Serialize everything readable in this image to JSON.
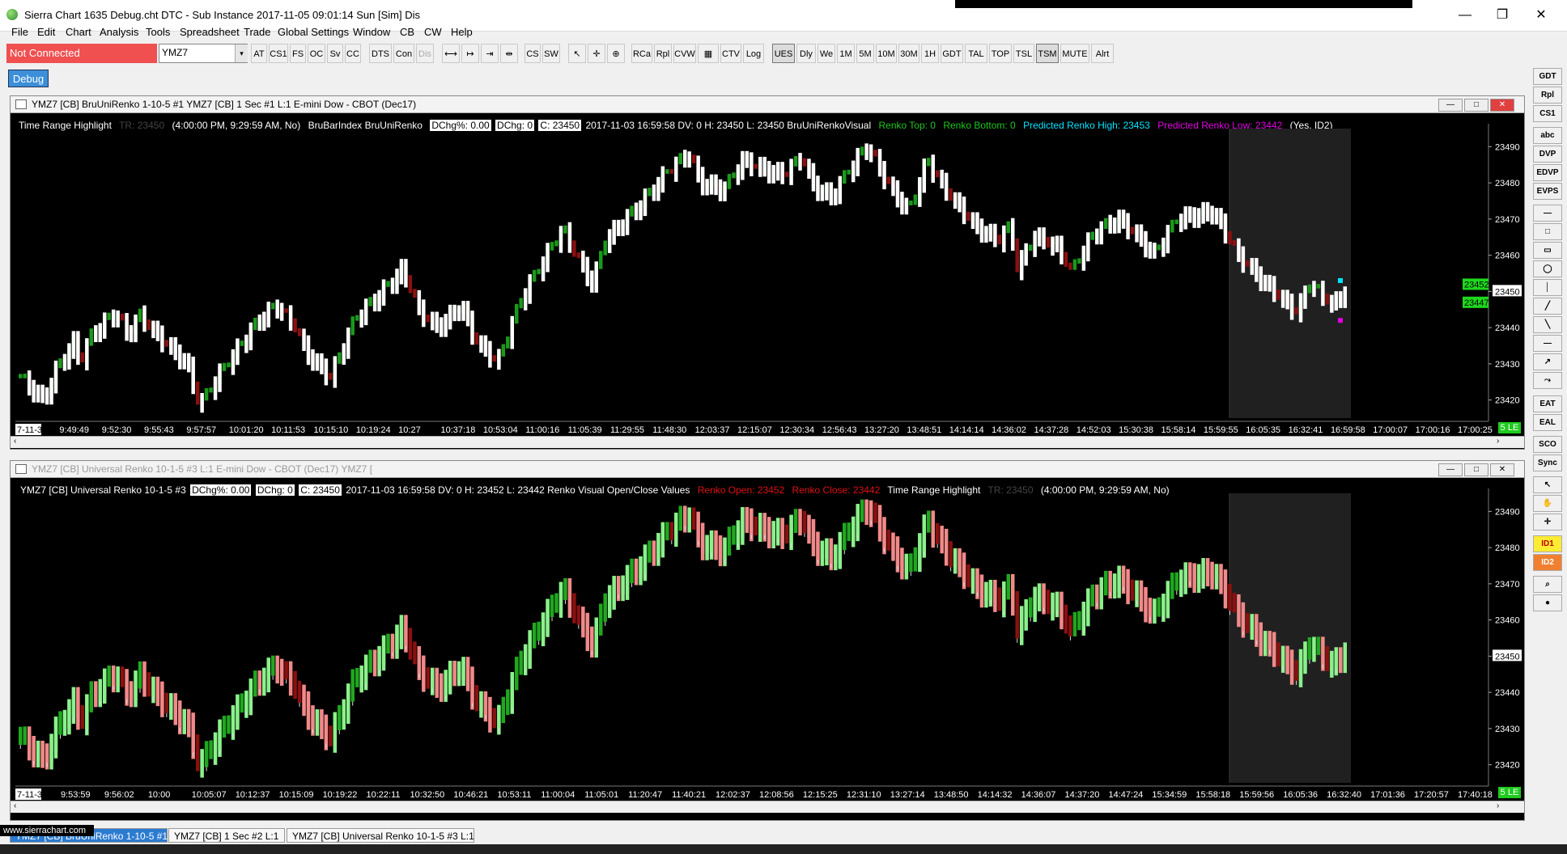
{
  "window": {
    "title": "Sierra Chart 1635 Debug.cht  DTC - Sub Instance 2017-11-05  09:01:14 Sun [Sim]  Dis",
    "minimize": "—",
    "restore": "❐",
    "close": "✕"
  },
  "menu": [
    "File",
    "Edit",
    "Chart",
    "Analysis",
    "Tools",
    "Spreadsheet",
    "Trade",
    "Global Settings",
    "Window",
    "CB",
    "CW",
    "Help"
  ],
  "toolbar": {
    "connection_status": "Not Connected",
    "symbol": "YMZ7",
    "dropdown_arrow": "▾",
    "debug_button": "Debug",
    "buttons": [
      {
        "label": "AT",
        "disabled": false
      },
      {
        "label": "CS1",
        "disabled": false
      },
      {
        "label": "FS",
        "disabled": false
      },
      {
        "label": "OC",
        "disabled": false
      },
      {
        "label": "Sv",
        "disabled": false
      },
      {
        "label": "CC",
        "disabled": false
      },
      {
        "label": "DTS",
        "disabled": false
      },
      {
        "label": "Con",
        "disabled": false
      },
      {
        "label": "Dis",
        "disabled": true
      },
      {
        "label": "⟷",
        "disabled": false
      },
      {
        "label": "↦",
        "disabled": false
      },
      {
        "label": "⇥",
        "disabled": false
      },
      {
        "label": "⇹",
        "disabled": false
      },
      {
        "label": "CS",
        "disabled": false
      },
      {
        "label": "SW",
        "disabled": false
      },
      {
        "label": "↖",
        "disabled": false
      },
      {
        "label": "✛",
        "disabled": false
      },
      {
        "label": "⊕",
        "disabled": false
      },
      {
        "label": "RCa",
        "disabled": false
      },
      {
        "label": "Rpl",
        "disabled": false
      },
      {
        "label": "CVW",
        "disabled": false
      },
      {
        "label": "▦",
        "disabled": false
      },
      {
        "label": "CTV",
        "disabled": false
      },
      {
        "label": "Log",
        "disabled": false
      },
      {
        "label": "UES",
        "disabled": false,
        "selected": true
      },
      {
        "label": "Dly",
        "disabled": false
      },
      {
        "label": "We",
        "disabled": false
      },
      {
        "label": "1M",
        "disabled": false
      },
      {
        "label": "5M",
        "disabled": false
      },
      {
        "label": "10M",
        "disabled": false
      },
      {
        "label": "30M",
        "disabled": false
      },
      {
        "label": "1H",
        "disabled": false
      },
      {
        "label": "GDT",
        "disabled": false
      },
      {
        "label": "TAL",
        "disabled": false
      },
      {
        "label": "TOP",
        "disabled": false
      },
      {
        "label": "TSL",
        "disabled": false
      },
      {
        "label": "TSM",
        "disabled": false,
        "selected": true
      },
      {
        "label": "MUTE",
        "disabled": false
      },
      {
        "label": "Alrt",
        "disabled": false
      }
    ]
  },
  "right_panel": [
    "GDT",
    "Rpl",
    "CS1",
    "abc",
    "DVP",
    "EDVP",
    "EVPS",
    "—",
    "□",
    "▭",
    "◯",
    "│",
    "╱",
    "╲",
    "―",
    "↗",
    "⤳",
    "EAT",
    "EAL",
    "SCO",
    "Sync",
    "↖",
    "✋",
    "✛",
    "ID1",
    "ID2",
    "⌕",
    "●"
  ],
  "chart1": {
    "title": "YMZ7 [CB] BruUniRenko 1-10-5 #1  YMZ7 [CB]  1 Sec  #1  L:1  E-mini Dow - CBOT (Dec17)",
    "info": {
      "study1": "Time Range Highlight",
      "tr_dim": "TR: 23450",
      "tr_vals": "(4:00:00 PM, 9:29:59 AM, No)",
      "study2": "BruBarIndex  BruUniRenko",
      "dchg_pct": "DChg%: 0.00",
      "dchg": "DChg: 0",
      "close": "C: 23450",
      "bar": "2017-11-03 16:59:58 DV: 0 H: 23450 L: 23450 BruUniRenkoVisual",
      "renko_top": "Renko Top: 0",
      "renko_bottom": "Renko Bottom: 0",
      "pred_high": "Predicted Renko High: 23453",
      "pred_low": "Predicted Renko Low: 23442",
      "tail": "(Yes, ID2)"
    },
    "price_ticks": [
      "23490",
      "23480",
      "23470",
      "23460",
      "23450",
      "23440",
      "23430",
      "23420"
    ],
    "price_markers": [
      "23452",
      "23447"
    ],
    "time_ticks": [
      "7-11-3",
      "9:49:49",
      "9:52:30",
      "9:55:43",
      "9:57:57",
      "10:01:20",
      "10:11:53",
      "10:15:10",
      "10:19:24",
      "10:27",
      "10:37:18",
      "10:53:04",
      "11:00:16",
      "11:05:39",
      "11:29:55",
      "11:48:30",
      "12:03:37",
      "12:15:07",
      "12:30:34",
      "12:56:43",
      "13:27:20",
      "13:48:51",
      "14:14:14",
      "14:36:02",
      "14:37:28",
      "14:52:03",
      "15:30:38",
      "15:58:14",
      "15:59:55",
      "16:05:35",
      "16:32:41",
      "16:59:58",
      "17:00:07",
      "17:00:16",
      "17:00:25"
    ],
    "sle": "5 LE",
    "colors": {
      "up": "#1a9a1a",
      "down": "#8b1010",
      "wick": "#ffffff",
      "highlight": "#202020",
      "cyan": "#00e5ff",
      "magenta": "#e000e0"
    }
  },
  "chart2": {
    "title": "YMZ7 [CB]  Universal Renko 10-1-5  #3  L:1  E-mini Dow - CBOT (Dec17)  YMZ7 [",
    "info": {
      "lead": "YMZ7 [CB]  Universal Renko 10-1-5  #3",
      "dchg_pct": "DChg%: 0.00",
      "dchg": "DChg: 0",
      "close": "C: 23450",
      "bar": "2017-11-03 16:59:58 DV: 0 H: 23452 L: 23442  Renko Visual Open/Close Values",
      "renko_open": "Renko Open: 23452",
      "renko_close": "Renko Close: 23442",
      "study": "Time Range Highlight",
      "tr_dim": "TR: 23450",
      "tr_vals": "(4:00:00 PM, 9:29:59 AM, No)"
    },
    "price_ticks": [
      "23490",
      "23480",
      "23470",
      "23460",
      "23450",
      "23440",
      "23430",
      "23420"
    ],
    "time_ticks": [
      "7-11-3",
      "9:53:59",
      "9:56:02",
      "10:00",
      "10:05:07",
      "10:12:37",
      "10:15:09",
      "10:19:22",
      "10:22:11",
      "10:32:50",
      "10:46:21",
      "10:53:11",
      "11:00:04",
      "11:05:01",
      "11:20:47",
      "11:40:21",
      "12:02:37",
      "12:08:56",
      "12:15:25",
      "12:31:10",
      "13:27:14",
      "13:48:50",
      "14:14:32",
      "14:36:07",
      "14:37:20",
      "14:47:24",
      "15:34:59",
      "15:58:18",
      "15:59:56",
      "16:05:36",
      "16:32:40",
      "17:01:36",
      "17:20:57",
      "17:40:18"
    ],
    "sle": "5 LE",
    "colors": {
      "up": "#1fa81f",
      "down": "#8b1010",
      "up_light": "#8cf08c",
      "down_light": "#f08a8a",
      "highlight": "#202020"
    }
  },
  "bottom_tabs": [
    "YMZ7 [CB] BruUniRenko 1-10-5 #1",
    "YMZ7 [CB]  1 Sec   #2  L:1",
    "YMZ7 [CB]  Universal Renko 10-1-5  #3  L:1"
  ],
  "watermark": "www.sierrachart.com",
  "path": [
    [
      0,
      23426
    ],
    [
      4,
      23420
    ],
    [
      6,
      23428
    ],
    [
      9,
      23436
    ],
    [
      10,
      23430
    ],
    [
      12,
      23438
    ],
    [
      16,
      23444
    ],
    [
      18,
      23438
    ],
    [
      20,
      23443
    ],
    [
      24,
      23436
    ],
    [
      28,
      23430
    ],
    [
      30,
      23418
    ],
    [
      33,
      23426
    ],
    [
      40,
      23442
    ],
    [
      43,
      23446
    ],
    [
      46,
      23440
    ],
    [
      48,
      23433
    ],
    [
      52,
      23426
    ],
    [
      56,
      23442
    ],
    [
      62,
      23452
    ],
    [
      64,
      23456
    ],
    [
      67,
      23444
    ],
    [
      70,
      23440
    ],
    [
      74,
      23446
    ],
    [
      76,
      23437
    ],
    [
      80,
      23430
    ],
    [
      84,
      23448
    ],
    [
      89,
      23462
    ],
    [
      91,
      23467
    ],
    [
      93,
      23460
    ],
    [
      96,
      23452
    ],
    [
      98,
      23464
    ],
    [
      104,
      23474
    ],
    [
      108,
      23482
    ],
    [
      112,
      23488
    ],
    [
      114,
      23480
    ],
    [
      118,
      23478
    ],
    [
      121,
      23486
    ],
    [
      124,
      23484
    ],
    [
      128,
      23482
    ],
    [
      131,
      23487
    ],
    [
      133,
      23479
    ],
    [
      136,
      23476
    ],
    [
      140,
      23486
    ],
    [
      142,
      23490
    ],
    [
      146,
      23478
    ],
    [
      149,
      23472
    ],
    [
      152,
      23486
    ],
    [
      155,
      23478
    ],
    [
      160,
      23468
    ],
    [
      164,
      23464
    ],
    [
      166,
      23468
    ],
    [
      167,
      23456
    ],
    [
      170,
      23465
    ],
    [
      174,
      23462
    ],
    [
      176,
      23455
    ],
    [
      180,
      23466
    ],
    [
      184,
      23470
    ],
    [
      188,
      23464
    ],
    [
      190,
      23460
    ],
    [
      194,
      23470
    ],
    [
      200,
      23472
    ],
    [
      204,
      23460
    ],
    [
      210,
      23450
    ],
    [
      214,
      23444
    ],
    [
      216,
      23452
    ],
    [
      220,
      23446
    ],
    [
      222,
      23450
    ]
  ]
}
